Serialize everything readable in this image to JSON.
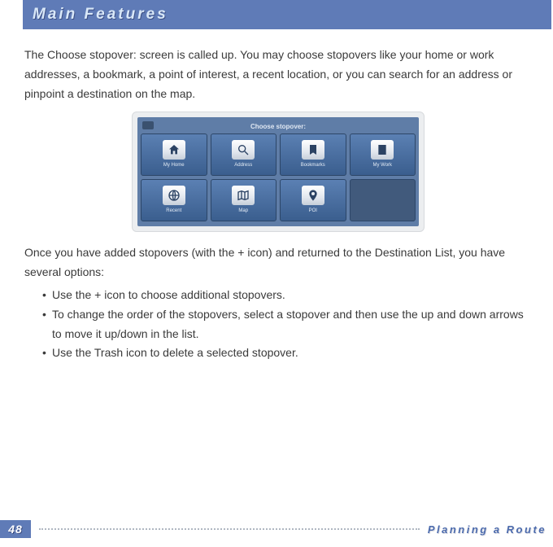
{
  "header": {
    "title": "Main Features"
  },
  "intro": "The Choose stopover: screen is called up. You may choose stopovers like your home or work addresses, a bookmark, a point of interest, a recent location, or you can search for an address or pinpoint a destination on the map.",
  "device": {
    "title": "Choose stopover:",
    "tiles": [
      {
        "label": "My Home",
        "icon": "home-icon"
      },
      {
        "label": "Address",
        "icon": "magnifier-icon"
      },
      {
        "label": "Bookmarks",
        "icon": "bookmark-icon"
      },
      {
        "label": "My Work",
        "icon": "building-icon"
      },
      {
        "label": "Recent",
        "icon": "globe-icon"
      },
      {
        "label": "Map",
        "icon": "map-icon"
      },
      {
        "label": "POI",
        "icon": "poi-icon"
      }
    ]
  },
  "after": "Once you have added stopovers (with the + icon) and returned to the Destination List, you have several options:",
  "bullets": [
    "Use the + icon to choose additional stopovers.",
    "To change the order of the stopovers, select a stopover and then use the up and down arrows to move it up/down in the list.",
    "Use the Trash icon to delete a selected stopover."
  ],
  "footer": {
    "page": "48",
    "section": "Planning a Route"
  }
}
